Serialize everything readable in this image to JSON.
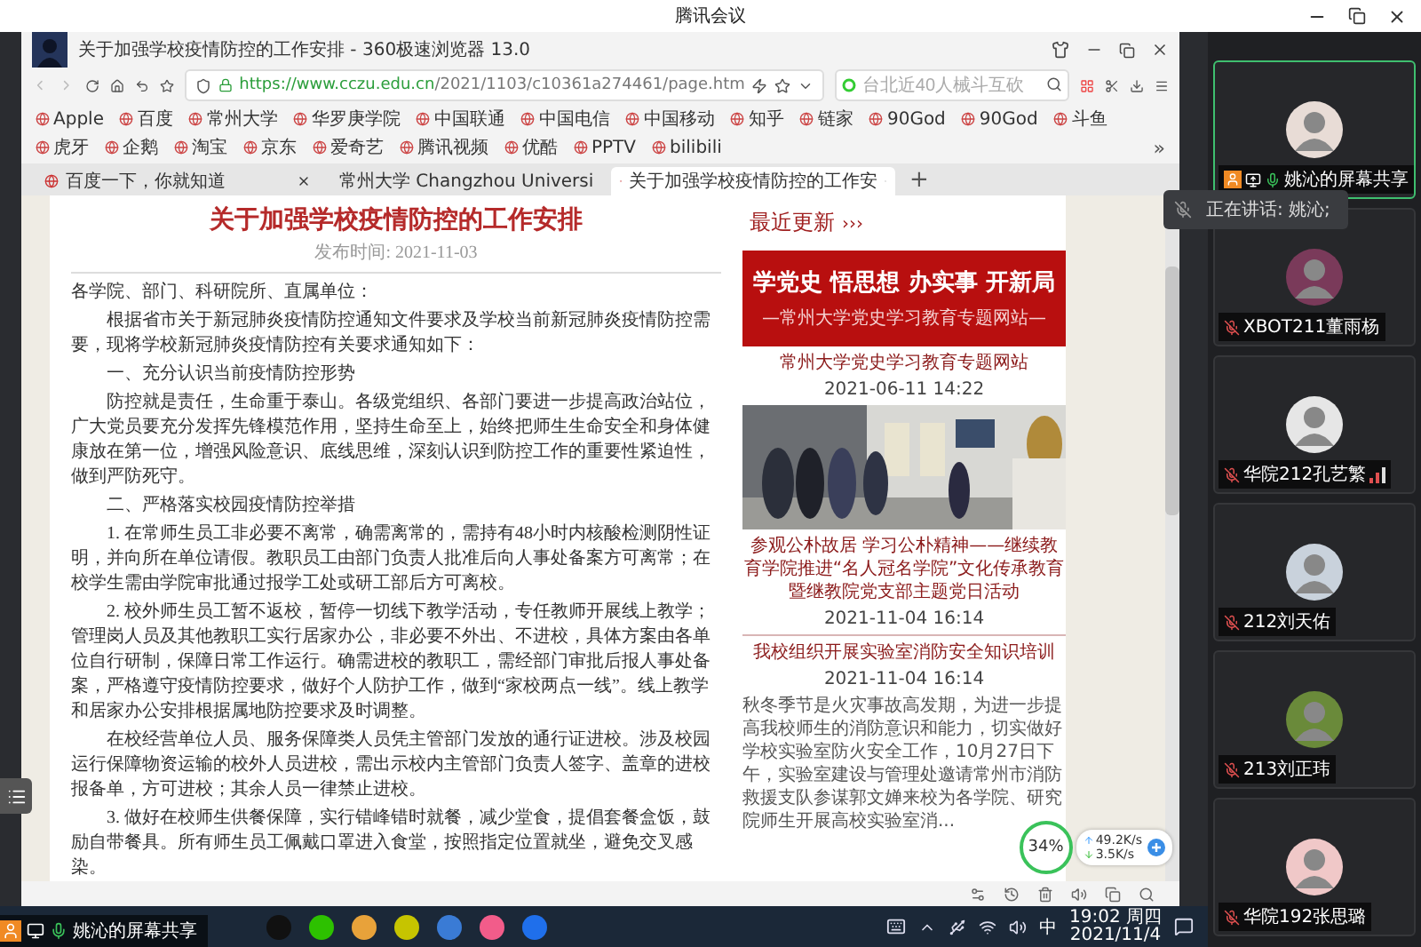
{
  "app_title": "腾讯会议",
  "browser": {
    "title": "关于加强学校疫情防控的工作安排 - 360极速浏览器 13.0",
    "url": "https://www.cczu.edu.cn/2021/1103/c10361a274461/page.htm",
    "search_placeholder": "台北近40人械斗互砍",
    "bookmarks": [
      "Apple",
      "百度",
      "常州大学",
      "华罗庚学院",
      "中国联通",
      "中国电信",
      "中国移动",
      "知乎",
      "链家",
      "90God",
      "90God",
      "斗鱼",
      "虎牙",
      "企鹅",
      "淘宝",
      "京东",
      "爱奇艺",
      "腾讯视频",
      "优酷",
      "PPTV",
      "bilibili"
    ],
    "more": "»",
    "tabs": [
      {
        "label": "百度一下，你就知道",
        "selected": false
      },
      {
        "label": "常州大学 Changzhou Universi",
        "selected": false
      },
      {
        "label": "关于加强学校疫情防控的工作安",
        "selected": true
      }
    ],
    "new_tab": "+"
  },
  "article": {
    "title": "关于加强学校疫情防控的工作安排",
    "date": "发布时间: 2021-11-03",
    "paragraphs": [
      {
        "kind": "opening",
        "text": "各学院、部门、科研院所、直属单位："
      },
      {
        "kind": "body",
        "text": "根据省市关于新冠肺炎疫情防控通知文件要求及学校当前新冠肺炎疫情防控需要，现将学校新冠肺炎疫情防控有关要求通知如下："
      },
      {
        "kind": "body",
        "text": "一、充分认识当前疫情防控形势"
      },
      {
        "kind": "body",
        "text": "防控就是责任，生命重于泰山。各级党组织、各部门要进一步提高政治站位，广大党员要充分发挥先锋模范作用，坚持生命至上，始终把师生生命安全和身体健康放在第一位，增强风险意识、底线思维，深刻认识到防控工作的重要性紧迫性，做到严防死守。"
      },
      {
        "kind": "body",
        "text": "二、严格落实校园疫情防控举措"
      },
      {
        "kind": "body",
        "text": "1. 在常师生员工非必要不离常，确需离常的，需持有48小时内核酸检测阴性证明，并向所在单位请假。教职员工由部门负责人批准后向人事处备案方可离常；在校学生需由学院审批通过报学工处或研工部后方可离校。"
      },
      {
        "kind": "body",
        "text": "2. 校外师生员工暂不返校，暂停一切线下教学活动，专任教师开展线上教学；管理岗人员及其他教职工实行居家办公，非必要不外出、不进校，具体方案由各单位自行研制，保障日常工作运行。确需进校的教职工，需经部门审批后报人事处备案，严格遵守疫情防控要求，做好个人防护工作，做到“家校两点一线”。线上教学和居家办公安排根据属地防控要求及时调整。"
      },
      {
        "kind": "body",
        "text": "在校经营单位人员、服务保障类人员凭主管部门发放的通行证进校。涉及校园运行保障物资运输的校外人员进校，需出示校内主管部门负责人签字、盖章的进校报备单，方可进校；其余人员一律禁止进校。"
      },
      {
        "kind": "body",
        "text": "3. 做好在校师生供餐保障，实行错峰错时就餐，减少堂食，提倡套餐盒饭，鼓励自带餐具。所有师生员工佩戴口罩进入食堂，按照指定位置就坐，避免交叉感染。"
      }
    ]
  },
  "news": {
    "heading": "最近更新",
    "arrows": "›››",
    "items": [
      {
        "kind": "banner",
        "banner_title": "学党史 悟思想 办实事 开新局",
        "banner_subtitle": "—常州大学党史学习教育专题网站—",
        "title": "常州大学党史学习教育专题网站",
        "date": "2021-06-11 14:22"
      },
      {
        "title": "参观公朴故居 学习公朴精神——继续教育学院推进“名人冠名学院”文化传承教育暨继教院党支部主题党日活动",
        "date": "2021-11-04 16:14"
      },
      {
        "kind": "text",
        "title": "我校组织开展实验室消防安全知识培训",
        "date": "2021-11-04 16:14",
        "summary": "秋冬季节是火灾事故高发期，为进一步提高我校师生的消防意识和能力，切实做好学校实验室防火安全工作，10月27日下午，实验室建设与管理处邀请常州市消防救援支队参谋郭文婵来校为各学院、研究院师生开展高校实验室消..."
      }
    ]
  },
  "meter": {
    "percent": "34",
    "unit": "%",
    "upload": "49.2K/s",
    "download": "3.5K/s"
  },
  "taskbar": {
    "ime": "中",
    "time": "19:02 周四",
    "date": "2021/11/4"
  },
  "share_label": "姚沁的屏幕共享",
  "speaking": "正在讲话: 姚沁;",
  "participants": [
    {
      "name": "姚沁的屏幕共享",
      "selected": true,
      "muted": false,
      "sharing": true,
      "signal": false
    },
    {
      "name": "XBOT211董雨杨",
      "selected": false,
      "muted": true,
      "sharing": false,
      "signal": false
    },
    {
      "name": "华院212孔艺繁",
      "selected": false,
      "muted": true,
      "sharing": false,
      "signal": true
    },
    {
      "name": "212刘天佑",
      "selected": false,
      "muted": true,
      "sharing": false,
      "signal": false
    },
    {
      "name": "213刘正玮",
      "selected": false,
      "muted": true,
      "sharing": false,
      "signal": false
    },
    {
      "name": "华院192张思璐",
      "selected": false,
      "muted": true,
      "sharing": false,
      "signal": false
    }
  ]
}
